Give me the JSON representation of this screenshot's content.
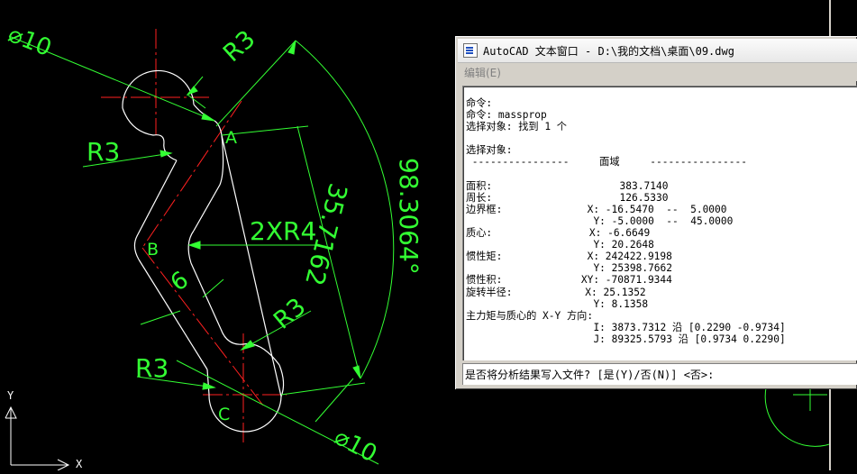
{
  "drawing": {
    "dimensions": {
      "dia_top": "⌀10",
      "r3_top": "R3",
      "r3_left": "R3",
      "two_x_r4": "2XR4",
      "angle": "98.3064°",
      "length": "35.7162",
      "six": "6",
      "r3_right": "R3",
      "r3_bottom": "R3",
      "dia_bottom": "⌀10"
    },
    "points": {
      "a": "A",
      "b": "B",
      "c": "C"
    },
    "ucs": {
      "y": "Y",
      "x": "X"
    }
  },
  "text_window": {
    "title": "AutoCAD 文本窗口 - D:\\我的文档\\桌面\\09.dwg",
    "menu_edit": "编辑(E)",
    "lines": [
      "命令:",
      "命令: massprop",
      "选择对象: 找到 1 个",
      "",
      "选择对象:",
      " ----------------     面域     ----------------",
      "",
      "面积:                     383.7140",
      "周长:                     126.5330",
      "边界框:              X: -16.5470  --  5.0000",
      "                     Y: -5.0000  --  45.0000",
      "质心:                X: -6.6649",
      "                     Y: 20.2648",
      "惯性矩:              X: 242422.9198",
      "                     Y: 25398.7662",
      "惯性积:             XY: -70871.9344",
      "旋转半径:            X: 25.1352",
      "                     Y: 8.1358",
      "主力矩与质心的 X-Y 方向:",
      "                     I: 3873.7312 沿 [0.2290 -0.9734]",
      "                     J: 89325.5793 沿 [0.9734 0.2290]"
    ],
    "prompt": "是否将分析结果写入文件? [是(Y)/否(N)] <否>:"
  },
  "colors": {
    "background": "#000000",
    "geometry": "#ffffff",
    "dimension": "#33ff33",
    "centerline": "#ff2020"
  }
}
